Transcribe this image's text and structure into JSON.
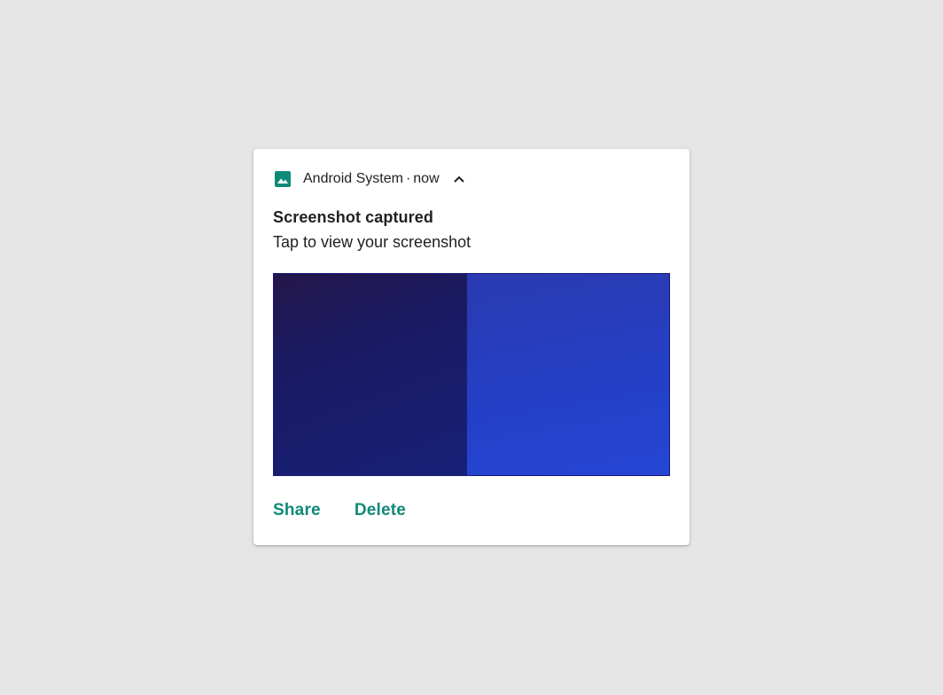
{
  "colors": {
    "background": "#e5e5e5",
    "card": "#ffffff",
    "accent": "#0f8a78",
    "text": "#202124"
  },
  "header": {
    "icon": "image-icon",
    "app_name": "Android System",
    "separator": "·",
    "time": "now",
    "expand_icon": "chevron-up-icon"
  },
  "notification": {
    "title": "Screenshot captured",
    "text": "Tap to view your screenshot"
  },
  "actions": {
    "share_label": "Share",
    "delete_label": "Delete"
  }
}
